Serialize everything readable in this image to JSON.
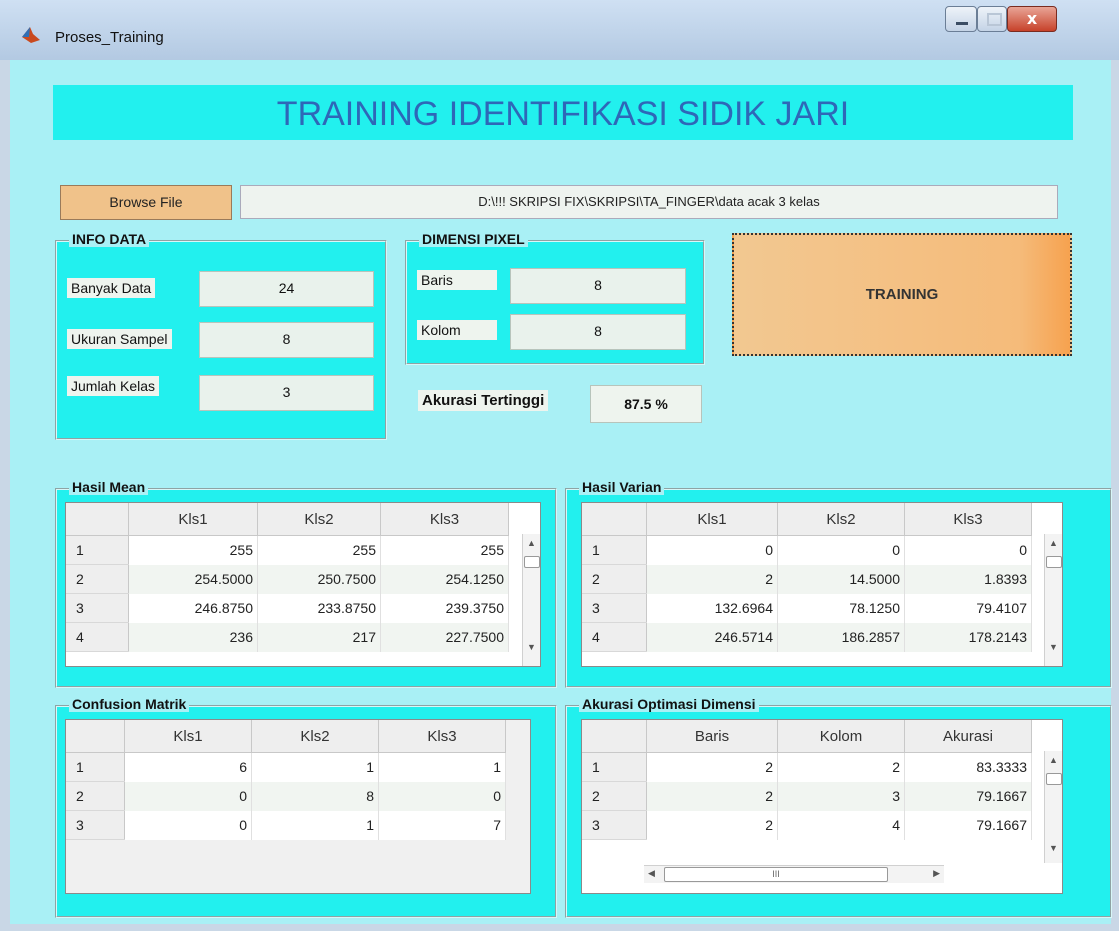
{
  "window": {
    "title": "Proses_Training",
    "minimize_glyph": "",
    "maximize_glyph": "",
    "close_glyph": "x"
  },
  "banner": {
    "title": "TRAINING IDENTIFIKASI SIDIK JARI"
  },
  "browse": {
    "label": "Browse File",
    "path": "D:\\!!! SKRIPSI FIX\\SKRIPSI\\TA_FINGER\\data acak 3 kelas"
  },
  "info_data": {
    "title": "INFO DATA",
    "banyak_data_label": "Banyak Data",
    "banyak_data_value": "24",
    "ukuran_sampel_label": "Ukuran Sampel",
    "ukuran_sampel_value": "8",
    "jumlah_kelas_label": "Jumlah Kelas",
    "jumlah_kelas_value": "3"
  },
  "dimensi_pixel": {
    "title": "DIMENSI PIXEL",
    "baris_label": "Baris",
    "baris_value": "8",
    "kolom_label": "Kolom",
    "kolom_value": "8"
  },
  "training_button": {
    "label": "TRAINING"
  },
  "akurasi": {
    "label": "Akurasi Tertinggi",
    "value": "87.5 %"
  },
  "hasil_mean": {
    "title": "Hasil Mean",
    "columns": [
      "Kls1",
      "Kls2",
      "Kls3"
    ],
    "rows": [
      {
        "idx": "1",
        "c1": "255",
        "c2": "255",
        "c3": "255"
      },
      {
        "idx": "2",
        "c1": "254.5000",
        "c2": "250.7500",
        "c3": "254.1250"
      },
      {
        "idx": "3",
        "c1": "246.8750",
        "c2": "233.8750",
        "c3": "239.3750"
      },
      {
        "idx": "4",
        "c1": "236",
        "c2": "217",
        "c3": "227.7500"
      }
    ]
  },
  "hasil_varian": {
    "title": "Hasil Varian",
    "columns": [
      "Kls1",
      "Kls2",
      "Kls3"
    ],
    "rows": [
      {
        "idx": "1",
        "c1": "0",
        "c2": "0",
        "c3": "0"
      },
      {
        "idx": "2",
        "c1": "2",
        "c2": "14.5000",
        "c3": "1.8393"
      },
      {
        "idx": "3",
        "c1": "132.6964",
        "c2": "78.1250",
        "c3": "79.4107"
      },
      {
        "idx": "4",
        "c1": "246.5714",
        "c2": "186.2857",
        "c3": "178.2143"
      }
    ]
  },
  "confusion": {
    "title": "Confusion Matrik",
    "columns": [
      "Kls1",
      "Kls2",
      "Kls3"
    ],
    "rows": [
      {
        "idx": "1",
        "c1": "6",
        "c2": "1",
        "c3": "1"
      },
      {
        "idx": "2",
        "c1": "0",
        "c2": "8",
        "c3": "0"
      },
      {
        "idx": "3",
        "c1": "0",
        "c2": "1",
        "c3": "7"
      }
    ]
  },
  "akurasi_optimasi": {
    "title": "Akurasi Optimasi Dimensi",
    "columns": [
      "Baris",
      "Kolom",
      "Akurasi"
    ],
    "rows": [
      {
        "idx": "1",
        "c1": "2",
        "c2": "2",
        "c3": "83.3333"
      },
      {
        "idx": "2",
        "c1": "2",
        "c2": "3",
        "c3": "79.1667"
      },
      {
        "idx": "3",
        "c1": "2",
        "c2": "4",
        "c3": "79.1667"
      }
    ],
    "hscroll_grip": "III"
  },
  "colors": {
    "panel": "#22f0ee",
    "background": "#a9f0f5",
    "title_text": "#2e67b8",
    "button": "#f0c28a"
  }
}
